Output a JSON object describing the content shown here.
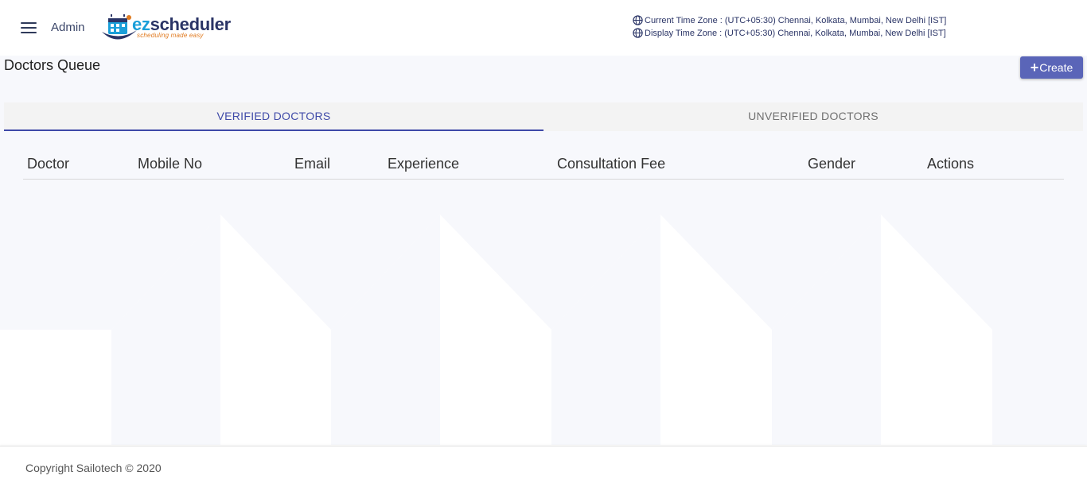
{
  "header": {
    "menu_icon": "hamburger-menu-icon",
    "admin_label": "Admin",
    "logo": {
      "brand_ez": "ez",
      "brand_rest": "scheduler",
      "tagline": "scheduling made easy",
      "colors": {
        "ez": "#1a9fd9",
        "rest": "#2a3466",
        "tagline": "#e07a1f"
      }
    },
    "current_time_zone": "Current Time Zone : (UTC+05:30) Chennai, Kolkata, Mumbai, New Delhi [IST]",
    "display_time_zone": "Display Time Zone : (UTC+05:30) Chennai, Kolkata, Mumbai, New Delhi [IST]",
    "globe_icon": "globe-icon"
  },
  "page": {
    "title": "Doctors Queue",
    "create_button": {
      "plus": "+",
      "label": "Create",
      "color": "#5a65b8"
    }
  },
  "tabs": [
    {
      "label": "Verified Doctors",
      "active": true
    },
    {
      "label": "Unverified Doctors",
      "active": false
    }
  ],
  "accent_color": "#3f4aa8",
  "table": {
    "columns": [
      "Doctor",
      "Mobile No",
      "Email",
      "Experience",
      "Consultation Fee",
      "Gender",
      "Actions"
    ],
    "rows": []
  },
  "footer": {
    "copyright": "Copyright Sailotech © 2020"
  }
}
